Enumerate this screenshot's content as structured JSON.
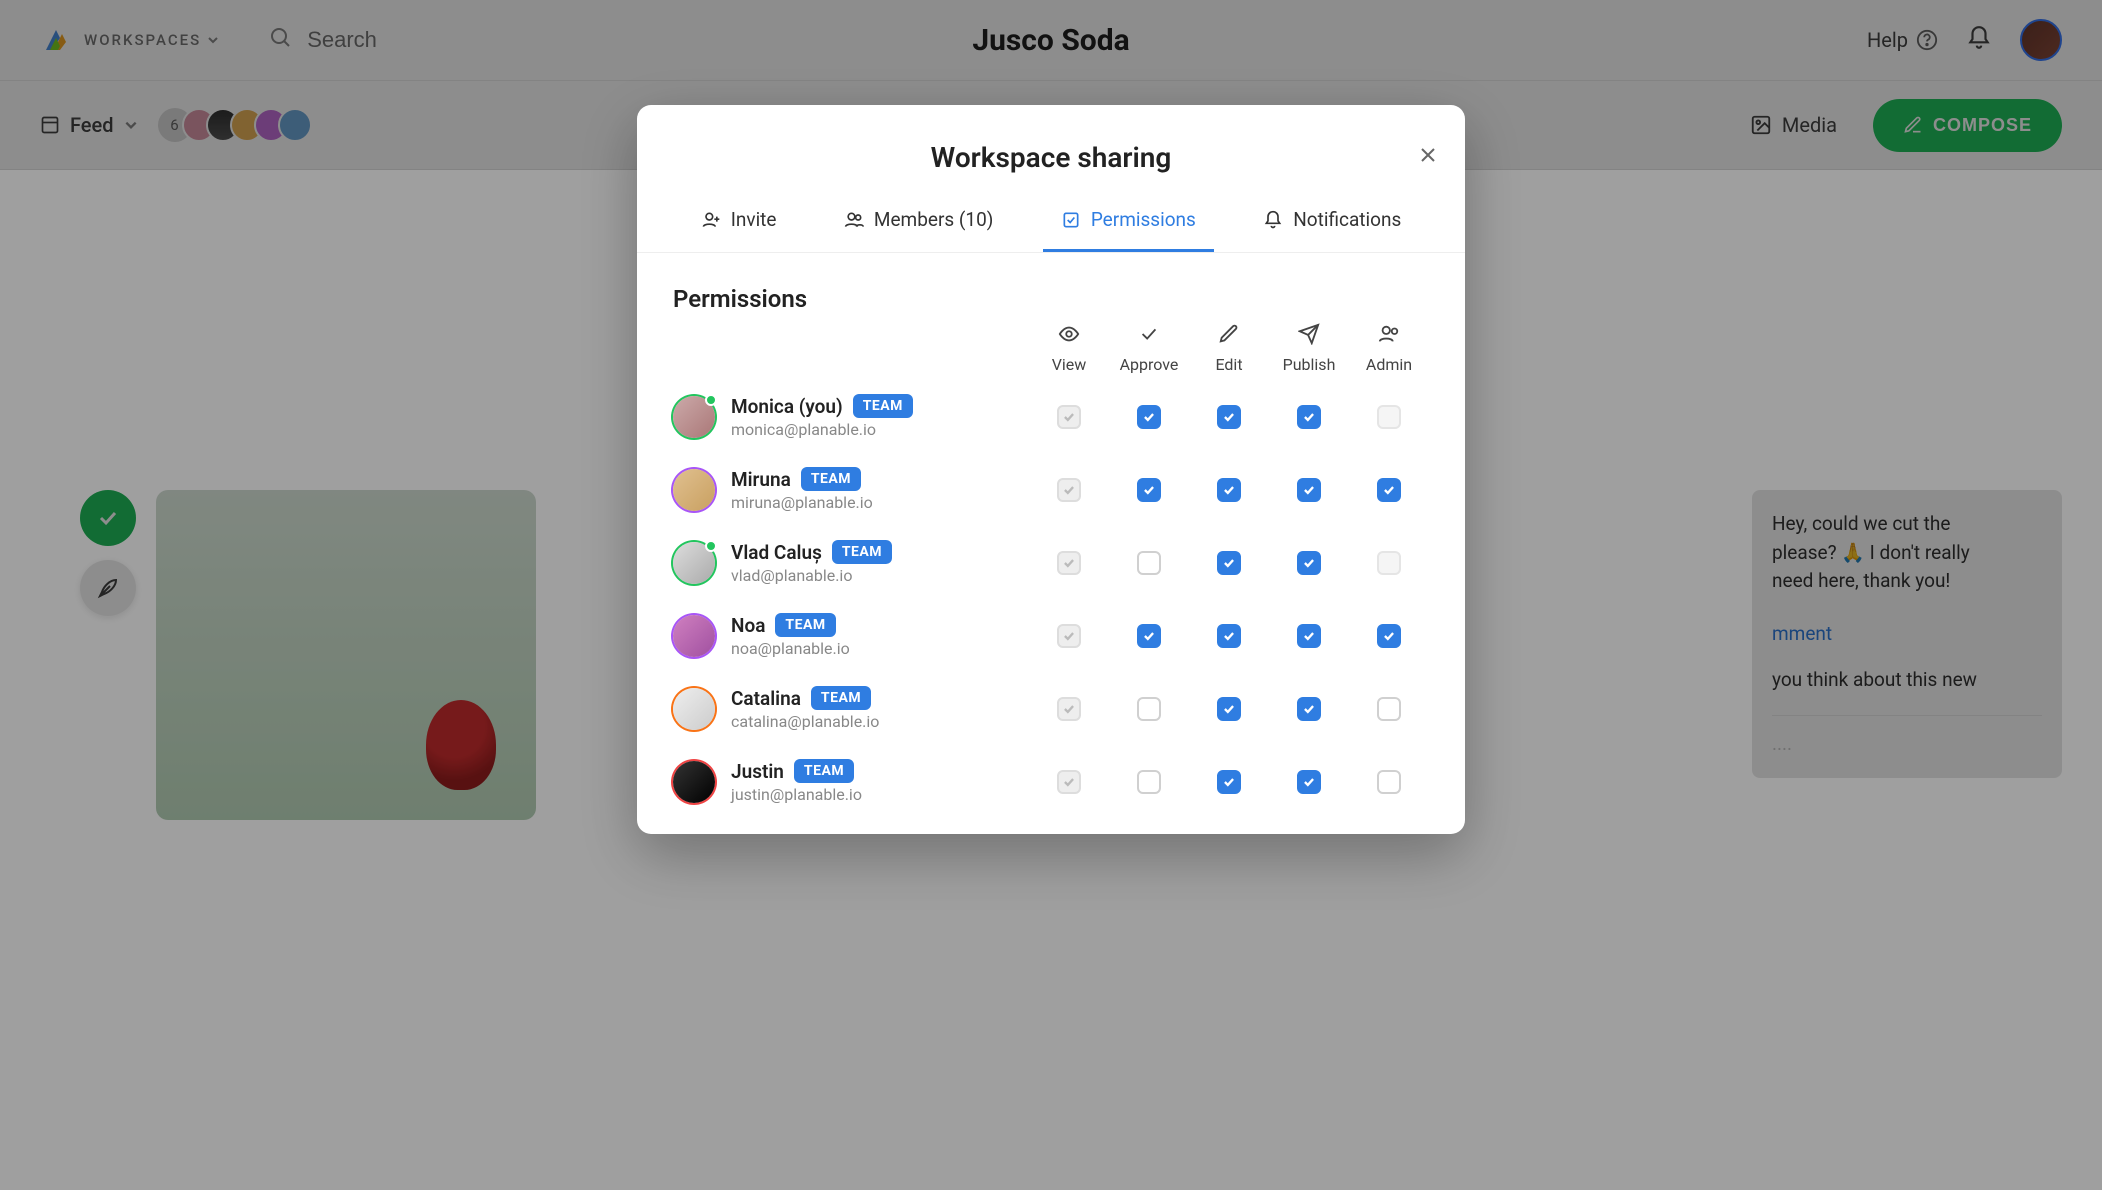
{
  "header": {
    "workspaces_label": "WORKSPACES",
    "search_placeholder": "Search",
    "workspace_title": "Jusco Soda",
    "help_label": "Help"
  },
  "toolbar": {
    "feed_label": "Feed",
    "avatar_count": "6",
    "media_label": "Media",
    "compose_label": "COMPOSE"
  },
  "comment": {
    "line1_part1": "Hey, could we cut the",
    "line1_part2": "please?",
    "line1_part3": "I don't really",
    "line1_part4": "need here, thank you!",
    "comment_link": "mment",
    "line2": "you think about this new"
  },
  "modal": {
    "title": "Workspace sharing",
    "tabs": {
      "invite": "Invite",
      "members": "Members (10)",
      "permissions": "Permissions",
      "notifications": "Notifications"
    },
    "section_title": "Permissions",
    "columns": {
      "view": "View",
      "approve": "Approve",
      "edit": "Edit",
      "publish": "Publish",
      "admin": "Admin"
    },
    "badge_team": "TEAM",
    "members": [
      {
        "name": "Monica (you)",
        "email": "monica@planable.io",
        "ring": "green",
        "color": "c1",
        "online": true,
        "perms": {
          "view": "locked-on",
          "approve": "on",
          "edit": "on",
          "publish": "on",
          "admin": "off-locked"
        }
      },
      {
        "name": "Miruna",
        "email": "miruna@planable.io",
        "ring": "purple",
        "color": "c2",
        "online": false,
        "perms": {
          "view": "locked-on",
          "approve": "on",
          "edit": "on",
          "publish": "on",
          "admin": "on"
        }
      },
      {
        "name": "Vlad Caluș",
        "email": "vlad@planable.io",
        "ring": "green",
        "color": "c3",
        "online": true,
        "perms": {
          "view": "locked-on",
          "approve": "off",
          "edit": "on",
          "publish": "on",
          "admin": "off-locked"
        }
      },
      {
        "name": "Noa",
        "email": "noa@planable.io",
        "ring": "purple",
        "color": "c4",
        "online": false,
        "perms": {
          "view": "locked-on",
          "approve": "on",
          "edit": "on",
          "publish": "on",
          "admin": "on"
        }
      },
      {
        "name": "Catalina",
        "email": "catalina@planable.io",
        "ring": "orange",
        "color": "c5",
        "online": false,
        "perms": {
          "view": "locked-on",
          "approve": "off",
          "edit": "on",
          "publish": "on",
          "admin": "off"
        }
      },
      {
        "name": "Justin",
        "email": "justin@planable.io",
        "ring": "red",
        "color": "c6",
        "online": false,
        "perms": {
          "view": "locked-on",
          "approve": "off",
          "edit": "on",
          "publish": "on",
          "admin": "off"
        }
      }
    ]
  }
}
